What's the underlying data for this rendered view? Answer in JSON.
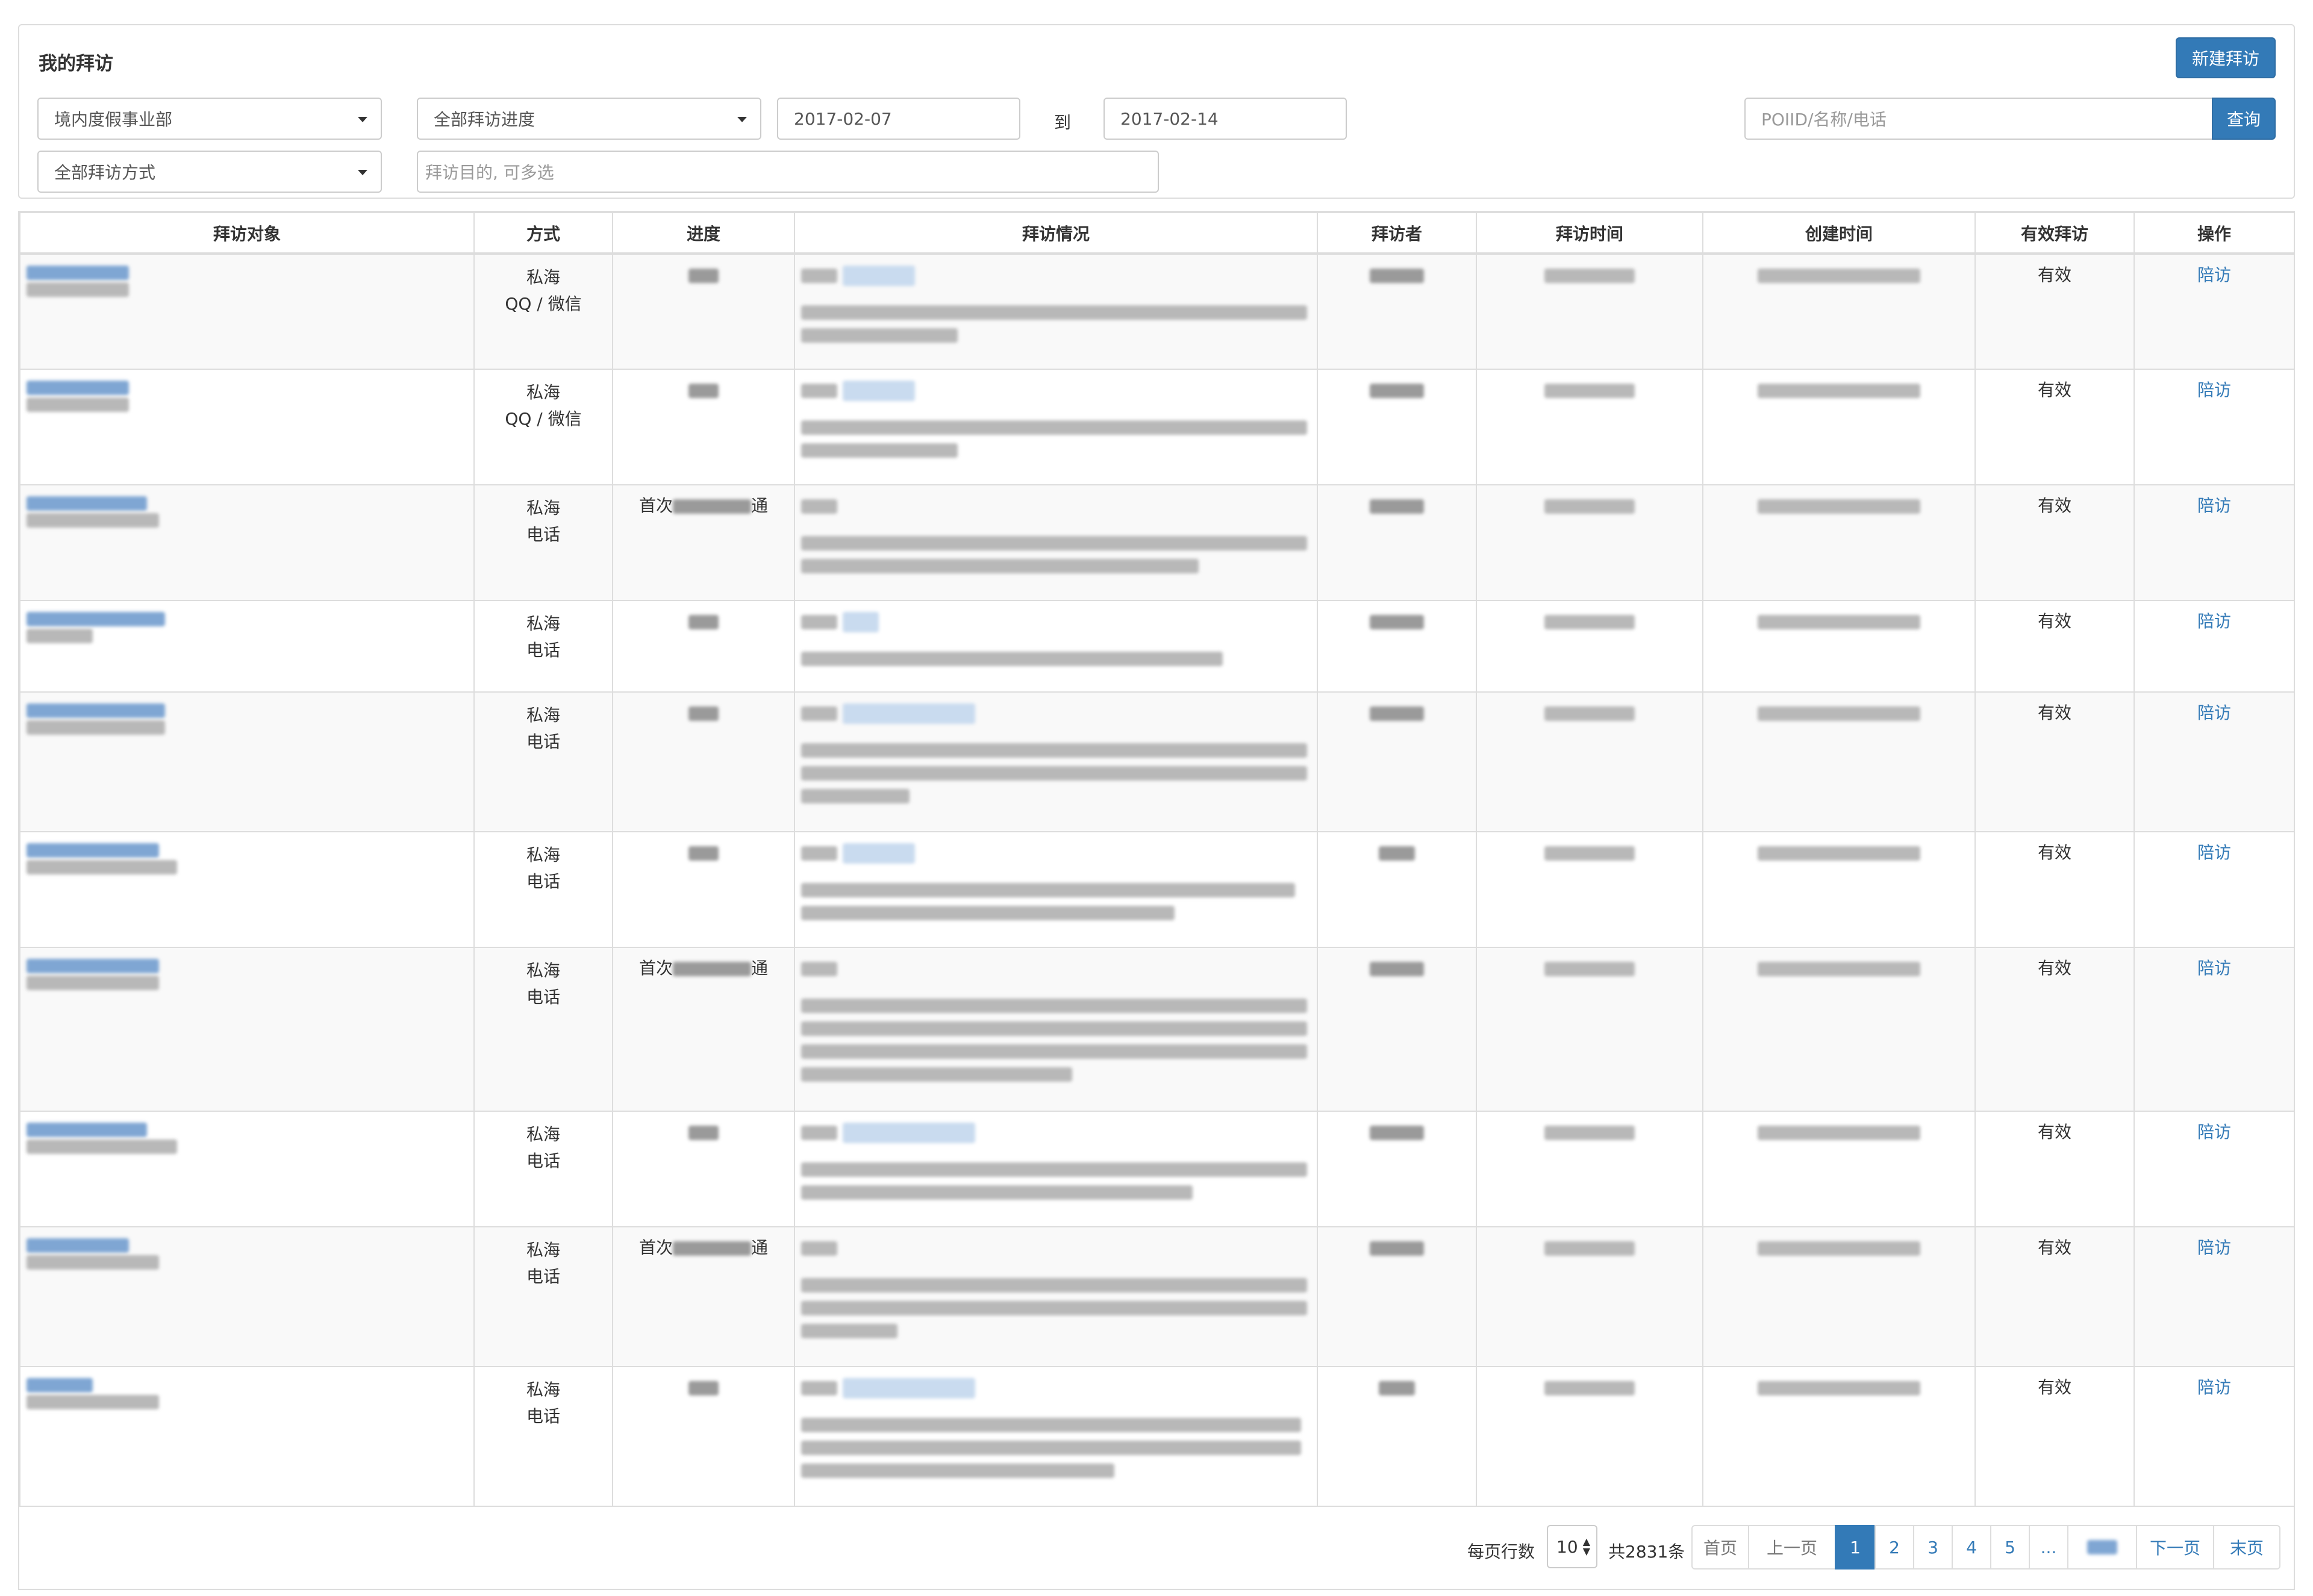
{
  "header": {
    "title": "我的拜访",
    "new_button": "新建拜访"
  },
  "filters": {
    "department": "境内度假事业部",
    "progress": "全部拜访进度",
    "date_from": "2017-02-07",
    "to_label": "到",
    "date_to": "2017-02-14",
    "search_placeholder": "POIID/名称/电话",
    "search_button": "查询",
    "method": "全部拜访方式",
    "purpose_placeholder": "拜访目的, 可多选"
  },
  "table": {
    "columns": [
      "拜访对象",
      "方式",
      "进度",
      "拜访情况",
      "拜访者",
      "拜访时间",
      "创建时间",
      "有效拜访",
      "操作"
    ],
    "rows": [
      {
        "method_1": "私海",
        "method_2": "QQ / 微信",
        "progress": "",
        "valid": "有效",
        "action": "陪访"
      },
      {
        "method_1": "私海",
        "method_2": "QQ / 微信",
        "progress": "",
        "valid": "有效",
        "action": "陪访"
      },
      {
        "method_1": "私海",
        "method_2": "电话",
        "progress_a": "首次",
        "progress_b": "通",
        "valid": "有效",
        "action": "陪访"
      },
      {
        "method_1": "私海",
        "method_2": "电话",
        "progress": "",
        "valid": "有效",
        "action": "陪访"
      },
      {
        "method_1": "私海",
        "method_2": "电话",
        "progress": "",
        "valid": "有效",
        "action": "陪访"
      },
      {
        "method_1": "私海",
        "method_2": "电话",
        "progress": "",
        "valid": "有效",
        "action": "陪访"
      },
      {
        "method_1": "私海",
        "method_2": "电话",
        "progress_a": "首次",
        "progress_b": "通",
        "valid": "有效",
        "action": "陪访"
      },
      {
        "method_1": "私海",
        "method_2": "电话",
        "progress": "",
        "valid": "有效",
        "action": "陪访"
      },
      {
        "method_1": "私海",
        "method_2": "电话",
        "progress_a": "首次",
        "progress_b": "通",
        "valid": "有效",
        "action": "陪访"
      },
      {
        "method_1": "私海",
        "method_2": "电话",
        "progress": "",
        "valid": "有效",
        "action": "陪访"
      }
    ]
  },
  "pagination": {
    "rows_label": "每页行数",
    "rows_value": "10",
    "total": "共2831条",
    "first": "首页",
    "prev": "上一页",
    "pages": [
      "1",
      "2",
      "3",
      "4",
      "5",
      "..."
    ],
    "next": "下一页",
    "last": "末页"
  }
}
